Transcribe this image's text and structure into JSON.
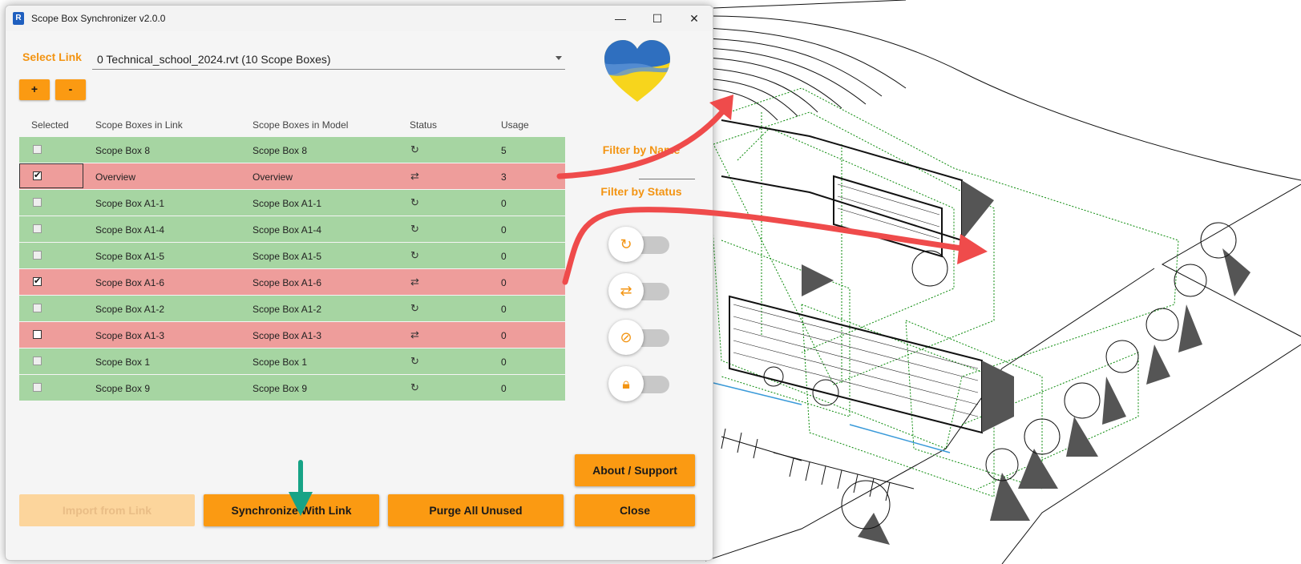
{
  "window": {
    "title": "Scope Box Synchronizer v2.0.0",
    "minimize_glyph": "—",
    "maximize_glyph": "☐",
    "close_glyph": "✕"
  },
  "link": {
    "label": "Select Link",
    "selected": "0 Technical_school_2024.rvt (10 Scope Boxes)"
  },
  "buttons": {
    "add": "+",
    "remove": "-",
    "import": "Import from Link",
    "synchronize": "Synchronize With Link",
    "purge": "Purge All Unused",
    "about": "About / Support",
    "close": "Close"
  },
  "grid": {
    "headers": [
      "Selected",
      "Scope Boxes in Link",
      "Scope Boxes in Model",
      "Status",
      "Usage"
    ],
    "rows": [
      {
        "selected": false,
        "link": "Scope Box 8",
        "model": "Scope Box 8",
        "status": "synced",
        "usage": "5"
      },
      {
        "selected": true,
        "link": "Overview",
        "model": "Overview",
        "status": "different",
        "usage": "3"
      },
      {
        "selected": false,
        "link": "Scope Box A1-1",
        "model": "Scope Box A1-1",
        "status": "synced",
        "usage": "0"
      },
      {
        "selected": false,
        "link": "Scope Box A1-4",
        "model": "Scope Box A1-4",
        "status": "synced",
        "usage": "0"
      },
      {
        "selected": false,
        "link": "Scope Box A1-5",
        "model": "Scope Box A1-5",
        "status": "synced",
        "usage": "0"
      },
      {
        "selected": true,
        "link": "Scope Box A1-6",
        "model": "Scope Box A1-6",
        "status": "different",
        "usage": "0"
      },
      {
        "selected": false,
        "link": "Scope Box A1-2",
        "model": "Scope Box A1-2",
        "status": "synced",
        "usage": "0"
      },
      {
        "selected": false,
        "link": "Scope Box A1-3",
        "model": "Scope Box A1-3",
        "status": "different",
        "usage": "0"
      },
      {
        "selected": false,
        "link": "Scope Box 1",
        "model": "Scope Box 1",
        "status": "synced",
        "usage": "0"
      },
      {
        "selected": false,
        "link": "Scope Box 9",
        "model": "Scope Box 9",
        "status": "synced",
        "usage": "0"
      }
    ]
  },
  "filters": {
    "by_name": "Filter by Name",
    "by_status": "Filter by Status",
    "toggles": [
      {
        "icon": "sync-off-icon",
        "on": false
      },
      {
        "icon": "repeat-off-icon",
        "on": false
      },
      {
        "icon": "unused-off-icon",
        "on": false
      },
      {
        "icon": "lock-off-icon",
        "on": false
      }
    ]
  },
  "colors": {
    "accent": "#fb9a12",
    "row_synced": "#a6d5a2",
    "row_different": "#ee9d9b",
    "arrow_red": "#ef4b4b",
    "arrow_teal": "#17a386"
  }
}
